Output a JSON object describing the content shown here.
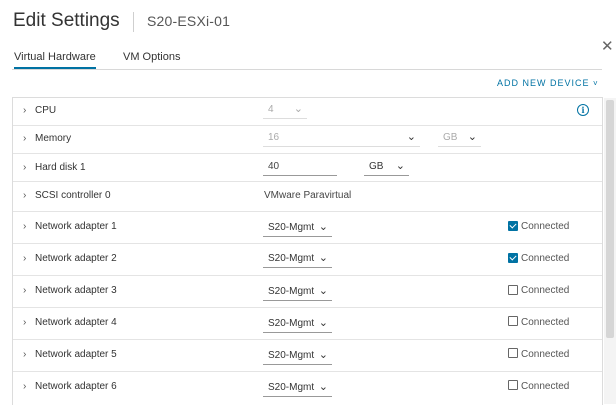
{
  "dialog": {
    "title": "Edit Settings",
    "vm_name": "S20-ESXi-01",
    "close_glyph": "✕"
  },
  "tabs": [
    {
      "label": "Virtual Hardware",
      "active": true
    },
    {
      "label": "VM Options",
      "active": false
    }
  ],
  "add_device": {
    "label": "ADD NEW DEVICE",
    "chevron": "˅"
  },
  "info_glyph": "i",
  "expander_glyph": "›",
  "hardware": {
    "cpu": {
      "label": "CPU",
      "value": "4"
    },
    "memory": {
      "label": "Memory",
      "value": "16",
      "unit": "GB"
    },
    "hard_disk": {
      "label": "Hard disk 1",
      "value": "40",
      "unit": "GB"
    },
    "scsi": {
      "label": "SCSI controller 0",
      "value": "VMware Paravirtual"
    },
    "network_adapters": [
      {
        "label": "Network adapter 1",
        "network": "S20-Mgmt",
        "connected_label": "Connected",
        "connected": true
      },
      {
        "label": "Network adapter 2",
        "network": "S20-Mgmt",
        "connected_label": "Connected",
        "connected": true
      },
      {
        "label": "Network adapter 3",
        "network": "S20-Mgmt",
        "connected_label": "Connected",
        "connected": false
      },
      {
        "label": "Network adapter 4",
        "network": "S20-Mgmt",
        "connected_label": "Connected",
        "connected": false
      },
      {
        "label": "Network adapter 5",
        "network": "S20-Mgmt",
        "connected_label": "Connected",
        "connected": false
      },
      {
        "label": "Network adapter 6",
        "network": "S20-Mgmt",
        "connected_label": "Connected",
        "connected": false
      }
    ]
  },
  "colors": {
    "accent": "#0072a3",
    "text": "#333333",
    "border": "#dcdcdc"
  }
}
